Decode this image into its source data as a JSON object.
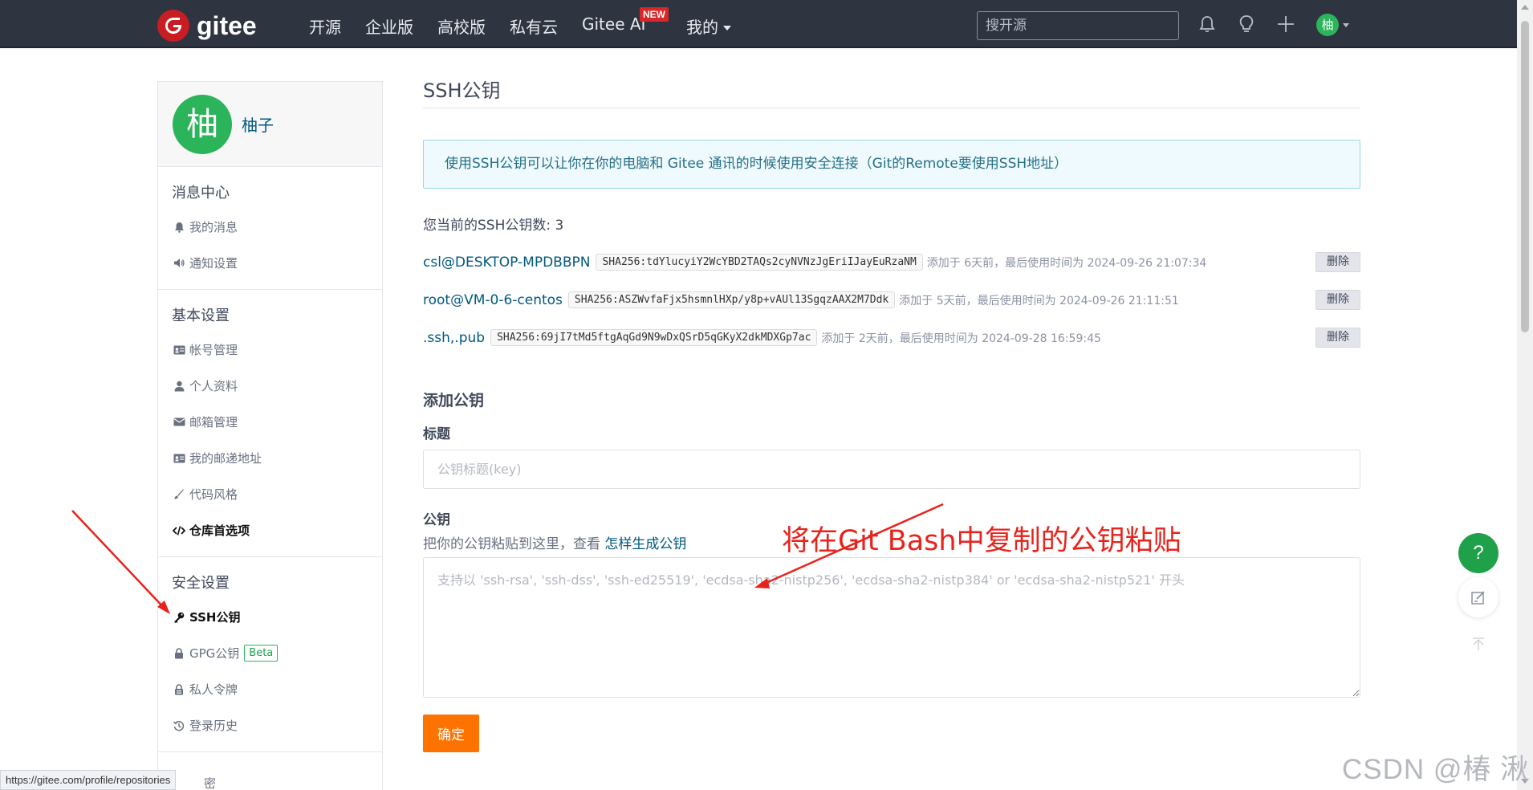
{
  "navbar": {
    "logo_text": "gitee",
    "items": [
      "开源",
      "企业版",
      "高校版",
      "私有云",
      "Gitee AI",
      "我的"
    ],
    "new_badge": "NEW",
    "search_placeholder": "搜开源",
    "avatar_char": "柚",
    "icons": [
      "bell-icon",
      "lightbulb-icon",
      "plus-icon"
    ]
  },
  "sidebar": {
    "profile": {
      "avatar_char": "柚",
      "name": "柚子"
    },
    "sections": [
      {
        "title": "消息中心",
        "items": [
          {
            "label": "我的消息",
            "icon": "bell-icon"
          },
          {
            "label": "通知设置",
            "icon": "speaker-icon"
          }
        ]
      },
      {
        "title": "基本设置",
        "items": [
          {
            "label": "帐号管理",
            "icon": "id-card-icon"
          },
          {
            "label": "个人资料",
            "icon": "user-icon"
          },
          {
            "label": "邮箱管理",
            "icon": "envelope-icon"
          },
          {
            "label": "我的邮递地址",
            "icon": "address-card-icon"
          },
          {
            "label": "代码风格",
            "icon": "brush-icon"
          },
          {
            "label": "仓库首选项",
            "icon": "code-icon"
          }
        ]
      },
      {
        "title": "安全设置",
        "items": [
          {
            "label": "SSH公钥",
            "icon": "key-icon",
            "active": true
          },
          {
            "label": "GPG公钥",
            "icon": "lock-icon",
            "badge": "Beta"
          },
          {
            "label": "私人令牌",
            "icon": "token-icon"
          },
          {
            "label": "登录历史",
            "icon": "history-icon"
          }
        ]
      }
    ]
  },
  "main": {
    "title": "SSH公钥",
    "info": "使用SSH公钥可以让你在你的电脑和 Gitee 通讯的时候使用安全连接（Git的Remote要使用SSH地址）",
    "key_count_label": "您当前的SSH公钥数: 3",
    "keys": [
      {
        "name": "csl@DESKTOP-MPDBBPN",
        "fingerprint": "SHA256:tdYlucyiY2WcYBD2TAQs2cyNVNzJgEriIJayEuRzaNM",
        "meta": "添加于 6天前，最后使用时间为 2024-09-26 21:07:34",
        "delete": "删除"
      },
      {
        "name": "root@VM-0-6-centos",
        "fingerprint": "SHA256:ASZWvfaFjx5hsmnlHXp/y8p+vAUl13SgqzAAX2M7Ddk",
        "meta": "添加于 5天前，最后使用时间为 2024-09-26 21:11:51",
        "delete": "删除"
      },
      {
        "name": ".ssh,.pub",
        "fingerprint": "SHA256:69jI7tMd5ftgAqGd9N9wDxQSrD5qGKyX2dkMDXGp7ac",
        "meta": "添加于 2天前，最后使用时间为 2024-09-28 16:59:45",
        "delete": "删除"
      }
    ],
    "add_title": "添加公钥",
    "title_label": "标题",
    "title_placeholder": "公钥标题(key)",
    "key_label": "公钥",
    "key_help": "把你的公钥粘贴到这里，查看",
    "key_help_link": "怎样生成公钥",
    "key_placeholder": "支持以 'ssh-rsa', 'ssh-dss', 'ssh-ed25519', 'ecdsa-sha2-nistp256', 'ecdsa-sha2-nistp384' or 'ecdsa-sha2-nistp521' 开头",
    "submit": "确定"
  },
  "annotation": {
    "text": "将在Git Bash中复制的公钥粘贴",
    "color": "#e8231c"
  },
  "float": {
    "help": "?",
    "icons": [
      "edit-icon",
      "back-to-top-icon"
    ]
  },
  "status_url": "https://gitee.com/profile/repositories",
  "watermark": "CSDN @椿  湫",
  "colors": {
    "navbar_bg": "#2e3440",
    "brand_red": "#c71d23",
    "accent_green": "#2bb45a",
    "link": "#005980",
    "submit_orange": "#fe7300"
  }
}
